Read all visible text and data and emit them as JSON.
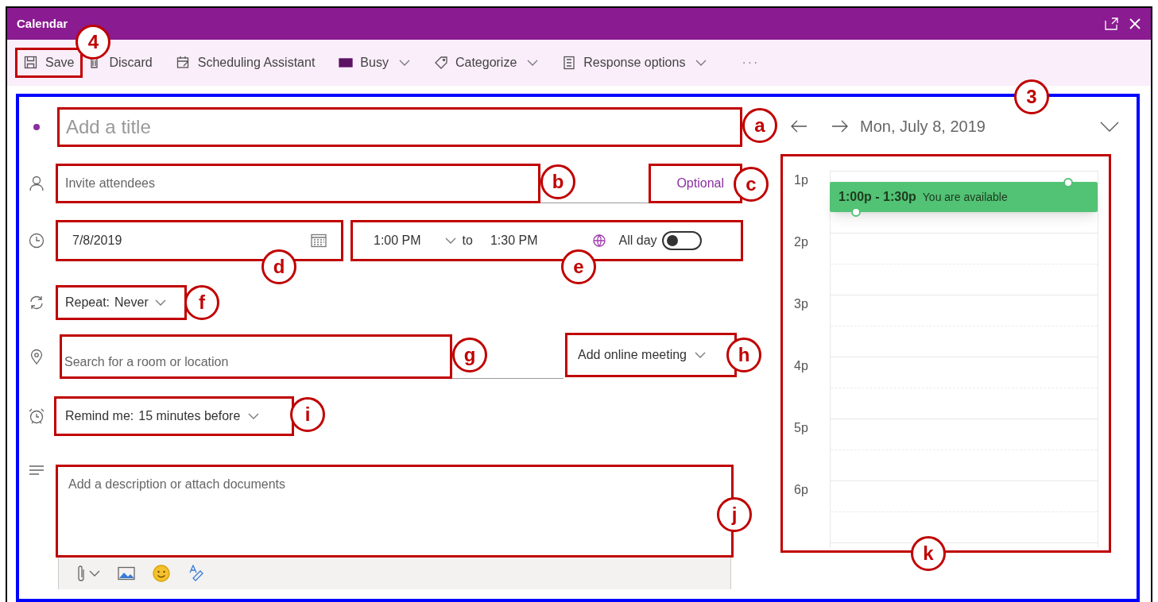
{
  "window": {
    "title": "Calendar"
  },
  "toolbar": [
    {
      "kind": "save",
      "label": "Save",
      "dropdown": false,
      "callout": "4"
    },
    {
      "kind": "discard",
      "label": "Discard",
      "dropdown": false
    },
    {
      "kind": "scheduling",
      "label": "Scheduling Assistant",
      "dropdown": false
    },
    {
      "kind": "busy",
      "label": "Busy",
      "dropdown": true
    },
    {
      "kind": "categorize",
      "label": "Categorize",
      "dropdown": true
    },
    {
      "kind": "response",
      "label": "Response options",
      "dropdown": true
    },
    {
      "kind": "more",
      "label": "···",
      "dropdown": false
    }
  ],
  "form_callout": "3",
  "title_field": {
    "placeholder": "Add a title",
    "callout": "a"
  },
  "attendees": {
    "placeholder": "Invite attendees",
    "callout": "b"
  },
  "optional": {
    "label": "Optional",
    "callout": "c"
  },
  "date": {
    "value": "7/8/2019",
    "callout": "d"
  },
  "time": {
    "start": "1:00 PM",
    "separator": "to",
    "end": "1:30 PM",
    "all_day_label": "All day",
    "all_day_on": false,
    "callout": "e"
  },
  "repeat": {
    "label": "Repeat:",
    "value": "Never",
    "callout": "f"
  },
  "location": {
    "placeholder": "Search for a room or location",
    "callout": "g"
  },
  "online_meeting": {
    "label": "Add online meeting",
    "callout": "h"
  },
  "reminder": {
    "label": "Remind me:",
    "value": "15 minutes before",
    "callout": "i"
  },
  "description": {
    "placeholder": "Add a description or attach documents",
    "callout": "j"
  },
  "day_view": {
    "date": "Mon, July 8, 2019",
    "hours": [
      "1p",
      "2p",
      "3p",
      "4p",
      "5p",
      "6p"
    ],
    "event": {
      "time": "1:00p - 1:30p",
      "status": "You are available"
    },
    "callout": "k"
  }
}
